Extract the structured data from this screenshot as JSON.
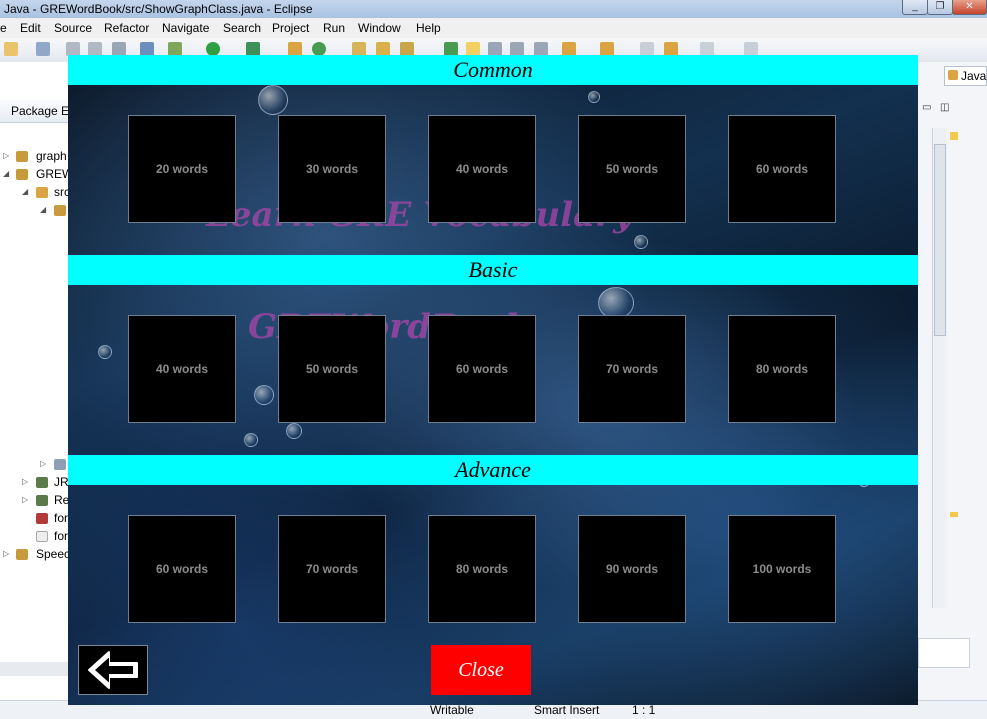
{
  "window": {
    "title": "Java - GREWordBook/src/ShowGraphClass.java - Eclipse",
    "controls": [
      "_",
      "❐",
      "✕"
    ]
  },
  "menu": [
    "e",
    "Edit",
    "Source",
    "Refactor",
    "Navigate",
    "Search",
    "Project",
    "Run",
    "Window",
    "Help"
  ],
  "perspective_label": "Java",
  "package_explorer": {
    "tab_label": "Package Ex",
    "tree": [
      {
        "label": "graph"
      },
      {
        "label": "GREW"
      },
      {
        "label": "src"
      },
      {
        "label": "JRI"
      },
      {
        "label": "Re"
      },
      {
        "label": "for"
      },
      {
        "label": "for"
      },
      {
        "label": "Speec"
      }
    ]
  },
  "status": {
    "writable": "Writable",
    "insert_mode": "Smart Insert",
    "position": "1 : 1"
  },
  "dialog": {
    "watermark_lines": [
      "Learn GRE Vocabulary",
      "GREWordBook"
    ],
    "sections": [
      {
        "title": "Common",
        "buttons": [
          "20 words",
          "30 words",
          "40 words",
          "50 words",
          "60 words"
        ]
      },
      {
        "title": "Basic",
        "buttons": [
          "40 words",
          "50 words",
          "60 words",
          "70 words",
          "80 words"
        ]
      },
      {
        "title": "Advance",
        "buttons": [
          "60 words",
          "70 words",
          "80 words",
          "90 words",
          "100 words"
        ]
      }
    ],
    "back_icon": "arrow-left-icon",
    "close_label": "Close"
  },
  "colors": {
    "section_header": "#00ffff",
    "word_button": "#000000",
    "word_button_text": "#8c8c8c",
    "close_button": "#ff0000"
  }
}
